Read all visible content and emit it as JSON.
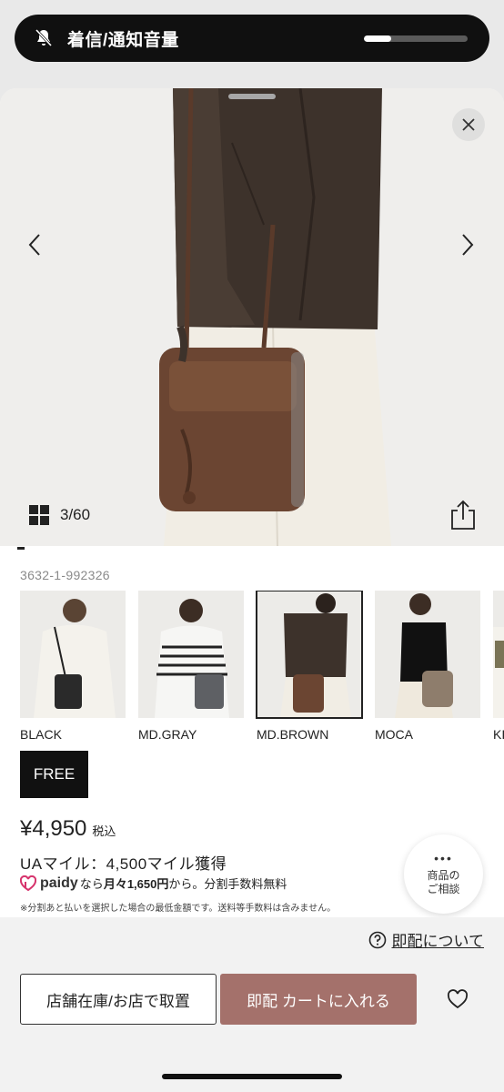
{
  "hud": {
    "label": "着信/通知音量",
    "icon": "bell-slash-icon",
    "volume_level": 0.26
  },
  "gallery": {
    "counter": "3/60"
  },
  "product": {
    "sku": "3632-1-992326",
    "colors": [
      {
        "name": "BLACK",
        "selected": false,
        "bag_color": "#2a2a2a"
      },
      {
        "name": "MD.GRAY",
        "selected": false,
        "bag_color": "#5e6064"
      },
      {
        "name": "MD.BROWN",
        "selected": true,
        "bag_color": "#6b4532"
      },
      {
        "name": "MOCA",
        "selected": false,
        "bag_color": "#8e7d6c"
      },
      {
        "name": "KI",
        "selected": false,
        "bag_color": "#7a7456"
      }
    ],
    "size": "FREE",
    "price": "¥4,950",
    "tax_label": "税込",
    "miles": "UAマイル：4,500マイル獲得",
    "paidy": {
      "brand": "paidy",
      "pre": "なら",
      "monthly": "月々1,650円",
      "post": "から。分割手数料無料"
    },
    "note": "※分割あと払いを選択した場合の最低金額です。送料等手数料は含みません。"
  },
  "consult": {
    "dots": "•••",
    "line1": "商品の",
    "line2": "ご相談"
  },
  "actions": {
    "about_label": "即配について",
    "store_button": "店舗在庫/お店で取置",
    "cart_button": "即配 カートに入れる"
  },
  "colors": {
    "cart_accent": "#a4716b",
    "hud_bg": "#101010"
  }
}
